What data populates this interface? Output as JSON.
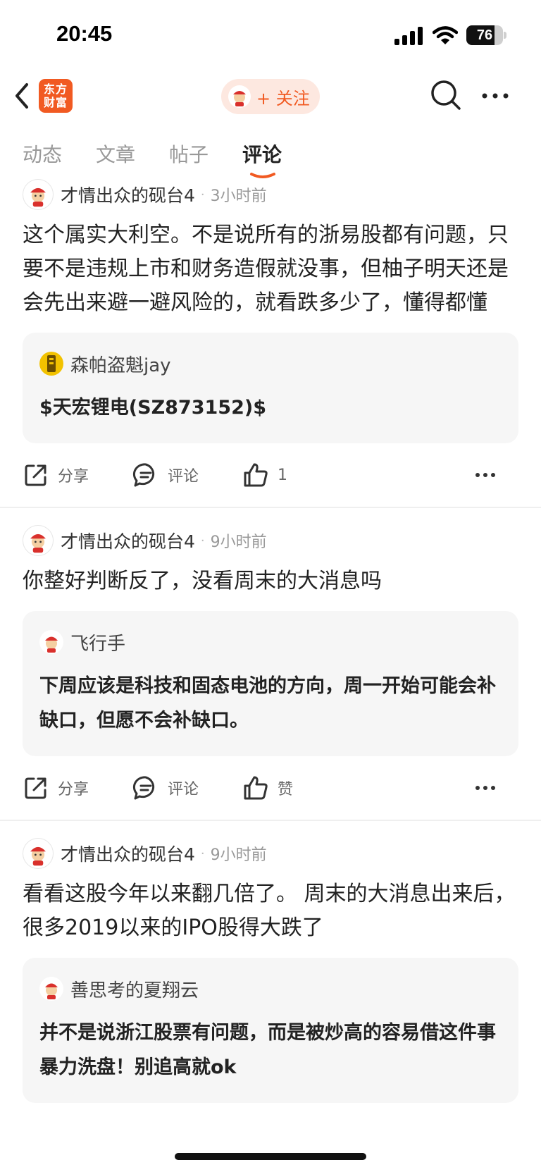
{
  "status_bar": {
    "time": "20:45",
    "battery": "76",
    "battery_level": 0.76
  },
  "nav": {
    "logo_text": "东方财富",
    "follow_label": "+ 关注"
  },
  "tabs": [
    {
      "label": "动态"
    },
    {
      "label": "文章"
    },
    {
      "label": "帖子"
    },
    {
      "label": "评论",
      "active": true
    }
  ],
  "posts": [
    {
      "author": "才情出众的砚台4",
      "time": "3小时前",
      "body": "这个属实大利空。不是说所有的浙易股都有问题，只要不是违规上市和财务造假就没事，但柚子明天还是会先出来避一避风险的，就看跌多少了，懂得都懂",
      "quote_author": "森帕盗魁jay",
      "quote_text": "$天宏锂电(SZ873152)$",
      "share_label": "分享",
      "comment_label": "评论",
      "like_label": "1"
    },
    {
      "author": "才情出众的砚台4",
      "time": "9小时前",
      "body": "你整好判断反了，没看周末的大消息吗",
      "quote_author": "飞行手",
      "quote_text": "下周应该是科技和固态电池的方向，周一开始可能会补缺口，但愿不会补缺口。",
      "share_label": "分享",
      "comment_label": "评论",
      "like_label": "赞"
    },
    {
      "author": "才情出众的砚台4",
      "time": "9小时前",
      "body": "看看这股今年以来翻几倍了。  周末的大消息出来后，很多2019以来的IPO股得大跌了",
      "quote_author": "善思考的夏翔云",
      "quote_text": "并不是说浙江股票有问题，而是被炒高的容易借这件事暴力洗盘！别追高就ok"
    }
  ],
  "colors": {
    "accent": "#f15a22",
    "follow_bg": "#fde8e0",
    "card_bg": "#f6f6f6"
  }
}
